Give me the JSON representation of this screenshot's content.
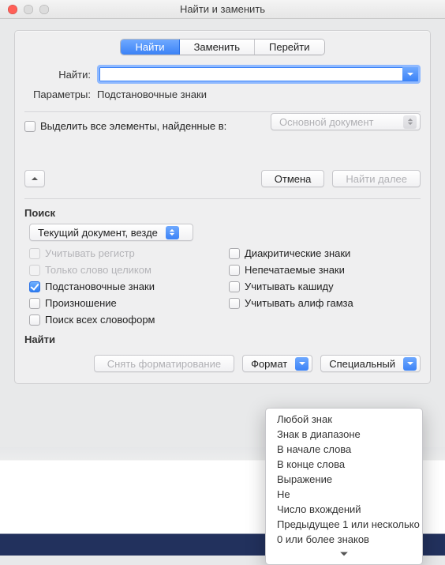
{
  "window": {
    "title": "Найти и заменить"
  },
  "tabs": {
    "find": "Найти",
    "replace": "Заменить",
    "goto": "Перейти"
  },
  "find": {
    "label": "Найти:",
    "value": "",
    "params_label": "Параметры:",
    "params_value": "Подстановочные знаки"
  },
  "highlight": {
    "label": "Выделить все элементы, найденные в:",
    "scope_selected": "Основной документ"
  },
  "buttons": {
    "cancel": "Отмена",
    "find_next": "Найти далее",
    "clear_fmt": "Снять форматирование",
    "format": "Формат",
    "special": "Специальный"
  },
  "search": {
    "heading": "Поиск",
    "scope_selected": "Текущий документ, везде",
    "options_left": [
      {
        "label": "Учитывать регистр",
        "checked": false,
        "disabled": true
      },
      {
        "label": "Только слово целиком",
        "checked": false,
        "disabled": true
      },
      {
        "label": "Подстановочные знаки",
        "checked": true,
        "disabled": false
      },
      {
        "label": "Произношение",
        "checked": false,
        "disabled": false
      },
      {
        "label": "Поиск всех словоформ",
        "checked": false,
        "disabled": false
      }
    ],
    "options_right": [
      {
        "label": "Диакритические знаки",
        "checked": false
      },
      {
        "label": "Непечатаемые знаки",
        "checked": false
      },
      {
        "label": "Учитывать кашиду",
        "checked": false
      },
      {
        "label": "Учитывать алиф гамза",
        "checked": false
      }
    ]
  },
  "find_section": {
    "heading": "Найти"
  },
  "special_menu": {
    "items": [
      "Любой знак",
      "Знак в диапазоне",
      "В начале слова",
      "В конце слова",
      "Выражение",
      "Не",
      "Число вхождений",
      "Предыдущее 1 или несколько",
      "0 или более знаков"
    ]
  }
}
